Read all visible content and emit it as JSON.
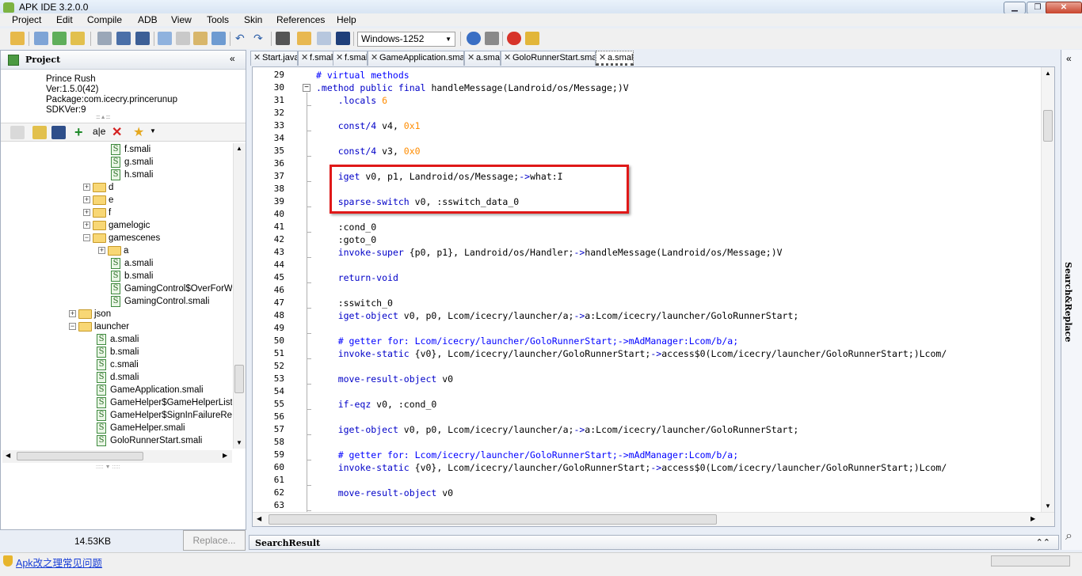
{
  "window": {
    "title": "APK IDE 3.2.0.0"
  },
  "menu": [
    "Project",
    "Edit",
    "Compile",
    "ADB",
    "View",
    "Tools",
    "Skin",
    "References",
    "Help"
  ],
  "toolbar": {
    "encoding": "Windows-1252"
  },
  "project": {
    "title": "Project",
    "info": [
      "Prince Rush",
      "Ver:1.5.0(42)",
      "Package:com.icecry.princerunup",
      "SDKVer:9"
    ],
    "file_size": "14.53KB",
    "replace_label": "Replace..."
  },
  "tree": [
    {
      "label": "f.smali",
      "type": "smali"
    },
    {
      "label": "g.smali",
      "type": "smali"
    },
    {
      "label": "h.smali",
      "type": "smali"
    },
    {
      "label": "d",
      "type": "folder"
    },
    {
      "label": "e",
      "type": "folder"
    },
    {
      "label": "f",
      "type": "folder"
    },
    {
      "label": "gamelogic",
      "type": "folder"
    },
    {
      "label": "gamescenes",
      "type": "folder-open"
    },
    {
      "label": "a",
      "type": "folder"
    },
    {
      "label": "a.smali",
      "type": "smali"
    },
    {
      "label": "b.smali",
      "type": "smali"
    },
    {
      "label": "GamingControl$OverForWha",
      "type": "smali"
    },
    {
      "label": "GamingControl.smali",
      "type": "smali"
    },
    {
      "label": "json",
      "type": "folder"
    },
    {
      "label": "launcher",
      "type": "folder-open"
    },
    {
      "label": "a.smali",
      "type": "smali"
    },
    {
      "label": "b.smali",
      "type": "smali"
    },
    {
      "label": "c.smali",
      "type": "smali"
    },
    {
      "label": "d.smali",
      "type": "smali"
    },
    {
      "label": "GameApplication.smali",
      "type": "smali"
    },
    {
      "label": "GameHelper$GameHelperLister",
      "type": "smali"
    },
    {
      "label": "GameHelper$SignInFailureReas",
      "type": "smali"
    },
    {
      "label": "GameHelper.smali",
      "type": "smali"
    },
    {
      "label": "GoloRunnerStart.smali",
      "type": "smali"
    }
  ],
  "tabs": [
    "Start.java",
    "f.smali",
    "f.smali",
    "GameApplication.smali",
    "a.smali",
    "GoloRunnerStart.smali",
    "a.smali"
  ],
  "active_tab": 6,
  "code": [
    {
      "n": "29",
      "t": "# virtual methods"
    },
    {
      "n": "30",
      "t": ".method public final handleMessage(Landroid/os/Message;)V"
    },
    {
      "n": "31",
      "t": "    .locals 6"
    },
    {
      "n": "32",
      "t": ""
    },
    {
      "n": "33",
      "t": "    const/4 v4, 0x1"
    },
    {
      "n": "34",
      "t": ""
    },
    {
      "n": "35",
      "t": "    const/4 v3, 0x0"
    },
    {
      "n": "36",
      "t": ""
    },
    {
      "n": "37",
      "t": "    iget v0, p1, Landroid/os/Message;->what:I"
    },
    {
      "n": "38",
      "t": ""
    },
    {
      "n": "39",
      "t": "    sparse-switch v0, :sswitch_data_0"
    },
    {
      "n": "40",
      "t": ""
    },
    {
      "n": "41",
      "t": "    :cond_0"
    },
    {
      "n": "42",
      "t": "    :goto_0"
    },
    {
      "n": "43",
      "t": "    invoke-super {p0, p1}, Landroid/os/Handler;->handleMessage(Landroid/os/Message;)V"
    },
    {
      "n": "44",
      "t": ""
    },
    {
      "n": "45",
      "t": "    return-void"
    },
    {
      "n": "46",
      "t": ""
    },
    {
      "n": "47",
      "t": "    :sswitch_0"
    },
    {
      "n": "48",
      "t": "    iget-object v0, p0, Lcom/icecry/launcher/a;->a:Lcom/icecry/launcher/GoloRunnerStart;"
    },
    {
      "n": "49",
      "t": ""
    },
    {
      "n": "50",
      "t": "    # getter for: Lcom/icecry/launcher/GoloRunnerStart;->mAdManager:Lcom/b/a;"
    },
    {
      "n": "51",
      "t": "    invoke-static {v0}, Lcom/icecry/launcher/GoloRunnerStart;->access$0(Lcom/icecry/launcher/GoloRunnerStart;)Lcom/"
    },
    {
      "n": "52",
      "t": ""
    },
    {
      "n": "53",
      "t": "    move-result-object v0"
    },
    {
      "n": "54",
      "t": ""
    },
    {
      "n": "55",
      "t": "    if-eqz v0, :cond_0"
    },
    {
      "n": "56",
      "t": ""
    },
    {
      "n": "57",
      "t": "    iget-object v0, p0, Lcom/icecry/launcher/a;->a:Lcom/icecry/launcher/GoloRunnerStart;"
    },
    {
      "n": "58",
      "t": ""
    },
    {
      "n": "59",
      "t": "    # getter for: Lcom/icecry/launcher/GoloRunnerStart;->mAdManager:Lcom/b/a;"
    },
    {
      "n": "60",
      "t": "    invoke-static {v0}, Lcom/icecry/launcher/GoloRunnerStart;->access$0(Lcom/icecry/launcher/GoloRunnerStart;)Lcom/"
    },
    {
      "n": "61",
      "t": ""
    },
    {
      "n": "62",
      "t": "    move-result-object v0"
    },
    {
      "n": "63",
      "t": ""
    }
  ],
  "search_result": {
    "title": "SearchResult"
  },
  "right_panel": {
    "label": "Search&Replace"
  },
  "status": {
    "faq": "Apk改之理常见问题"
  },
  "colors": {
    "accent": "#0000c8",
    "highlight_box": "#e01818",
    "comment": "#0000ff",
    "number": "#ff8c00"
  }
}
